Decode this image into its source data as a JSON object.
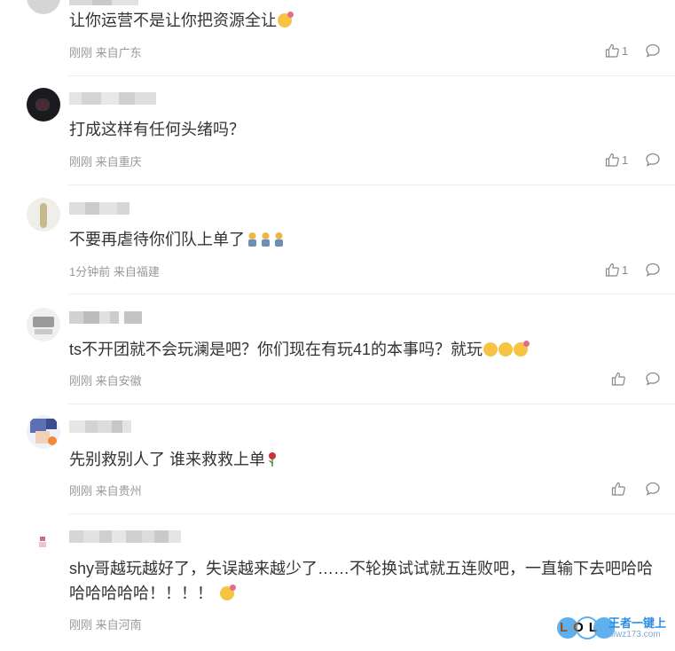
{
  "comments": [
    {
      "text": "让你运营不是让你把资源全让",
      "time": "刚刚",
      "location": "来自广东",
      "likes": "1"
    },
    {
      "text": "打成这样有任何头绪吗？",
      "time": "刚刚",
      "location": "来自重庆",
      "likes": "1"
    },
    {
      "text": "不要再虐待你们队上单了",
      "time": "1分钟前",
      "location": "来自福建",
      "likes": "1"
    },
    {
      "text": "ts不开团就不会玩澜是吧？你们现在有玩41的本事吗？就玩",
      "time": "刚刚",
      "location": "来自安徽",
      "likes": ""
    },
    {
      "text": "先别救别人了 谁来救救上单",
      "time": "刚刚",
      "location": "来自贵州",
      "likes": ""
    },
    {
      "text": "shy哥越玩越好了，失误越来越少了……不轮换试试就五连败吧，一直输下去吧哈哈哈哈哈哈哈！！！！",
      "time": "刚刚",
      "location": "来自河南",
      "likes": ""
    }
  ],
  "watermark": {
    "left": "LOL",
    "right": "王者一键上",
    "url": "lolwz173.com"
  },
  "colors": {
    "meta": "#999999",
    "text": "#333333",
    "divider": "#ececec",
    "watermark_blue": "#2f8de4"
  }
}
